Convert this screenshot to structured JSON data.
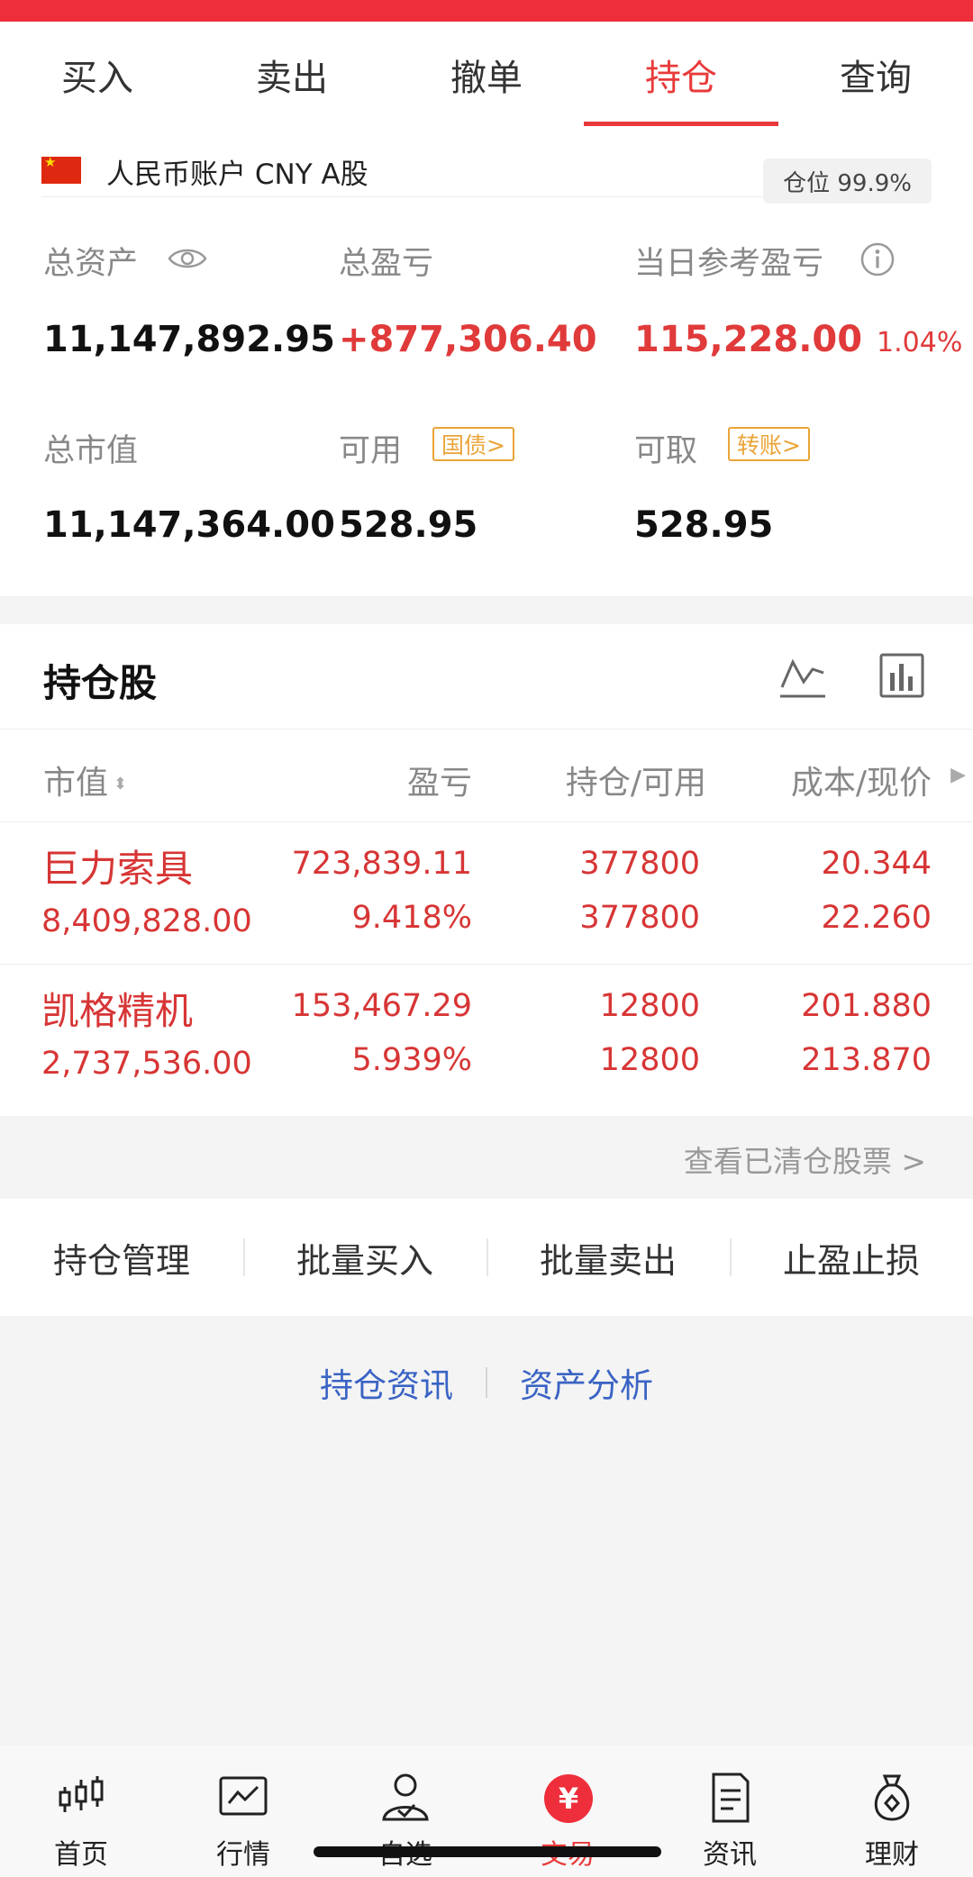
{
  "tabs": [
    {
      "label": "买入"
    },
    {
      "label": "卖出"
    },
    {
      "label": "撤单"
    },
    {
      "label": "持仓",
      "active": true
    },
    {
      "label": "查询"
    }
  ],
  "account": {
    "name": "人民币账户 CNY A股",
    "position_ratio": "仓位 99.9%",
    "total_assets_label": "总资产",
    "total_assets": "11,147,892.95",
    "total_pnl_label": "总盈亏",
    "total_pnl": "+877,306.40",
    "daily_pnl_label": "当日参考盈亏",
    "daily_pnl": "115,228.00",
    "daily_pnl_pct": "1.04%",
    "market_value_label": "总市值",
    "market_value": "11,147,364.00",
    "available_label": "可用",
    "available": "528.95",
    "bond_tag": "国债>",
    "withdrawable_label": "可取",
    "withdrawable": "528.95",
    "transfer_tag": "转账>"
  },
  "holdings": {
    "title": "持仓股",
    "columns": {
      "market_value": "市值",
      "pnl": "盈亏",
      "position": "持仓/可用",
      "cost": "成本/现价"
    },
    "rows": [
      {
        "name": "巨力索具",
        "market_value": "8,409,828.00",
        "pnl": "723,839.11",
        "pnl_pct": "9.418%",
        "position": "377800",
        "available": "377800",
        "cost": "20.344",
        "price": "22.260"
      },
      {
        "name": "凯格精机",
        "market_value": "2,737,536.00",
        "pnl": "153,467.29",
        "pnl_pct": "5.939%",
        "position": "12800",
        "available": "12800",
        "cost": "201.880",
        "price": "213.870"
      }
    ],
    "cleared_link": "查看已清仓股票 >"
  },
  "actions": [
    "持仓管理",
    "批量买入",
    "批量卖出",
    "止盈止损"
  ],
  "links": [
    "持仓资讯",
    "资产分析"
  ],
  "nav": [
    {
      "label": "首页",
      "icon": "candlestick-icon"
    },
    {
      "label": "行情",
      "icon": "chart-icon"
    },
    {
      "label": "自选",
      "icon": "user-check-icon"
    },
    {
      "label": "交易",
      "icon": "yuan-icon",
      "glyph": "¥",
      "active": true
    },
    {
      "label": "资讯",
      "icon": "document-icon"
    },
    {
      "label": "理财",
      "icon": "money-bag-icon"
    }
  ],
  "colors": {
    "accent": "#e83a3a",
    "link": "#3a63c4",
    "tag": "#eaa437"
  }
}
